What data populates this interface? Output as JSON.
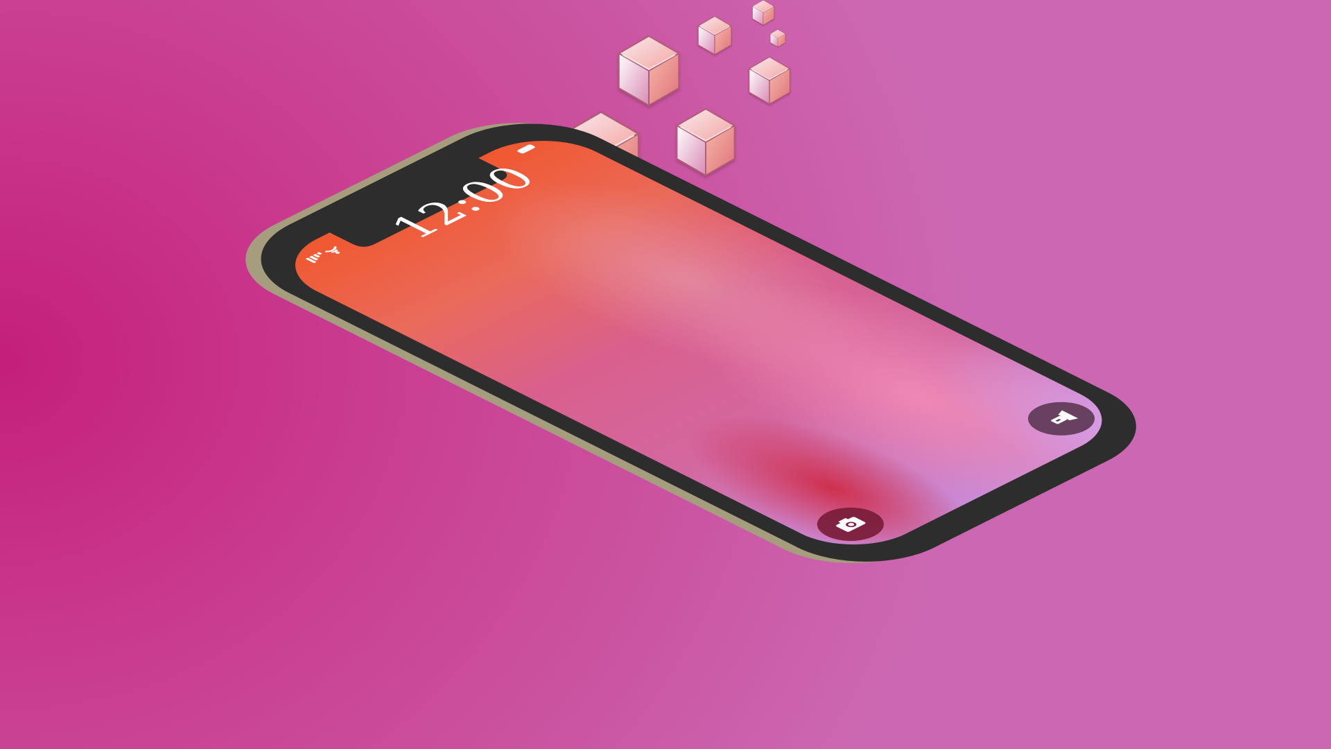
{
  "lock_screen": {
    "clock": "12:00"
  },
  "status_bar": {
    "icons": [
      "signal-bars-icon",
      "wifi-icon",
      "battery-icon"
    ]
  },
  "quick_actions": {
    "icons": [
      "camera-icon",
      "flashlight-icon"
    ]
  },
  "colors": {
    "background_deep": "#c41f79",
    "background_light": "#cc68b3",
    "phone_bezel": "#2d2d2d",
    "phone_edge": "#a59d7e",
    "screen_top": "#f0582f",
    "screen_middle": "#d9608e",
    "screen_bottom_red": "#cf2c48",
    "screen_corner_lilac": "#c98ad6"
  },
  "decorations": {
    "floating_cubes": 8
  }
}
